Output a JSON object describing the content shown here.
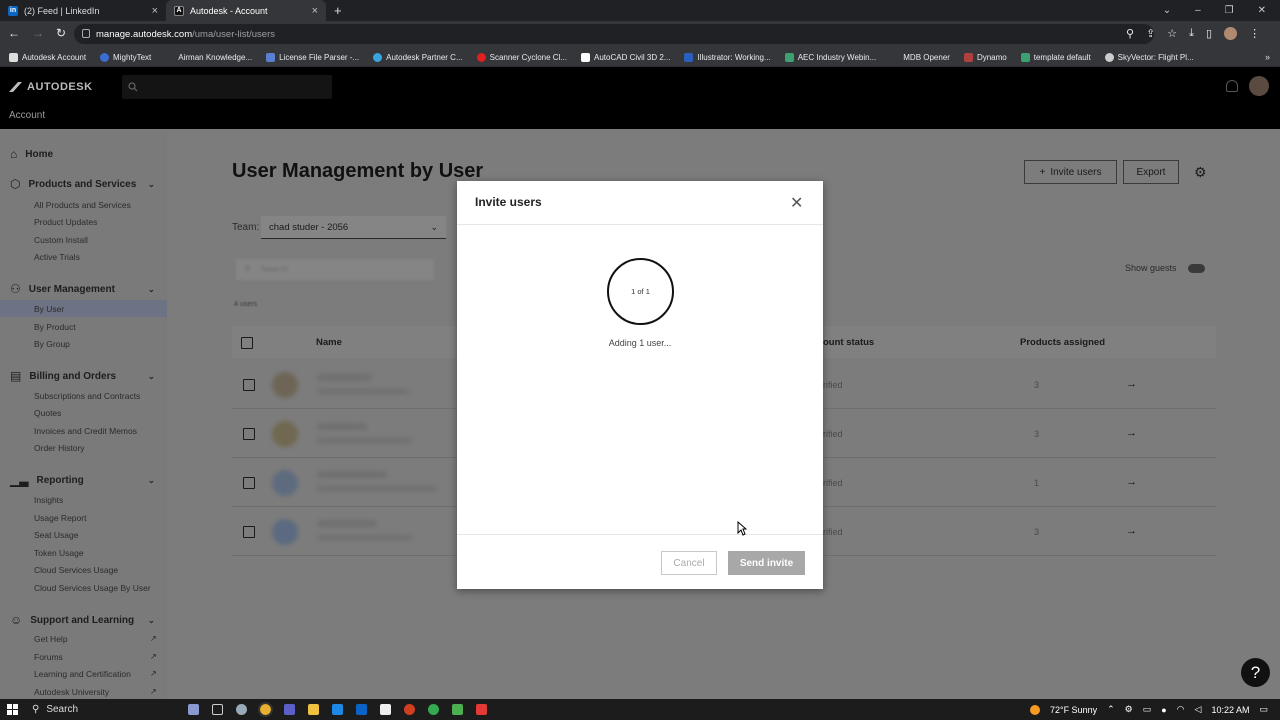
{
  "browser": {
    "tabs": [
      {
        "title": "(2) Feed | LinkedIn",
        "icon": "linkedin-icon"
      },
      {
        "title": "Autodesk - Account",
        "icon": "autodesk-icon"
      }
    ],
    "url_host": "manage.autodesk.com",
    "url_path": "/uma/user-list/users",
    "bookmarks": [
      "Autodesk Account",
      "MightyText",
      "Airman Knowledge...",
      "License File Parser -...",
      "Autodesk Partner C...",
      "Scanner Cyclone Cl...",
      "AutoCAD Civil 3D 2...",
      "Illustrator: Working...",
      "AEC Industry Webin...",
      "MDB Opener",
      "Dynamo",
      "template default",
      "SkyVector: Flight Pl..."
    ]
  },
  "app": {
    "brand": "AUTODESK",
    "section": "Account"
  },
  "sidebar": {
    "home": "Home",
    "products": {
      "label": "Products and Services",
      "items": [
        "All Products and Services",
        "Product Updates",
        "Custom Install",
        "Active Trials"
      ]
    },
    "users": {
      "label": "User Management",
      "items": [
        "By User",
        "By Product",
        "By Group"
      ]
    },
    "billing": {
      "label": "Billing and Orders",
      "items": [
        "Subscriptions and Contracts",
        "Quotes",
        "Invoices and Credit Memos",
        "Order History"
      ]
    },
    "reporting": {
      "label": "Reporting",
      "items": [
        "Insights",
        "Usage Report",
        "Seat Usage",
        "Token Usage",
        "Cloud Services Usage",
        "Cloud Services Usage By User"
      ]
    },
    "support": {
      "label": "Support and Learning",
      "items": [
        "Get Help",
        "Forums",
        "Learning and Certification",
        "Autodesk University"
      ]
    }
  },
  "main": {
    "title": "User Management by User",
    "invite_label": "Invite users",
    "export_label": "Export",
    "team_label": "Team:",
    "team_value": "chad studer - 2056",
    "search_placeholder": "Search",
    "users_count": "4 users",
    "show_guests": "Show guests",
    "columns": {
      "name": "Name",
      "status": "ount status",
      "products": "Products assigned"
    },
    "rows": [
      {
        "status": "rified",
        "products": "3"
      },
      {
        "status": "rified",
        "products": "3"
      },
      {
        "status": "rified",
        "products": "1"
      },
      {
        "status": "rified",
        "products": "3"
      }
    ]
  },
  "modal": {
    "title": "Invite users",
    "progress": "1 of 1",
    "status": "Adding 1 user...",
    "cancel": "Cancel",
    "send": "Send invite"
  },
  "taskbar": {
    "search": "Search",
    "weather": "72°F  Sunny",
    "time": "10:22 AM"
  }
}
